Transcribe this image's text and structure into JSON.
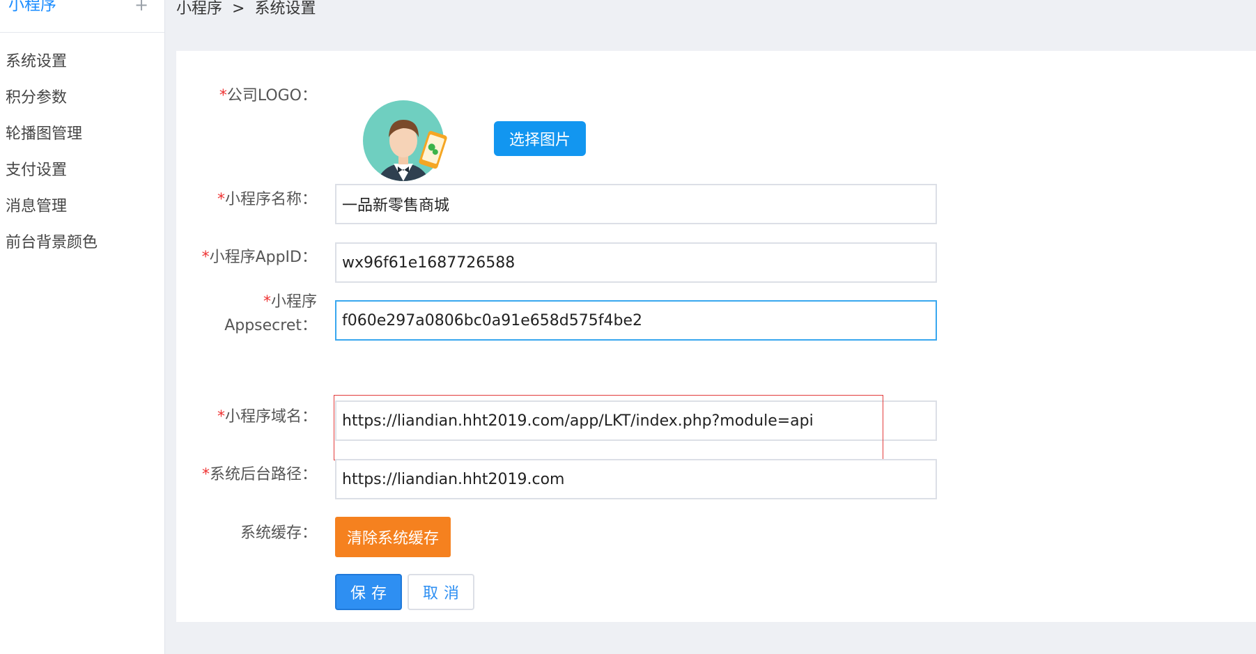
{
  "sidebar": {
    "title": "小程序",
    "plus": "+",
    "items": [
      {
        "label": "系统设置"
      },
      {
        "label": "积分参数"
      },
      {
        "label": "轮播图管理"
      },
      {
        "label": "支付设置"
      },
      {
        "label": "消息管理"
      },
      {
        "label": "前台背景颜色"
      }
    ]
  },
  "breadcrumb": {
    "root": "小程序",
    "separator": ">",
    "current": "系统设置"
  },
  "form": {
    "required_mark": "*",
    "logo": {
      "label": "公司LOGO：",
      "choose_button": "选择图片"
    },
    "app_name": {
      "label": "小程序名称：",
      "value": "一品新零售商城"
    },
    "app_id": {
      "label": "小程序AppID：",
      "value": "wx96f61e1687726588"
    },
    "app_secret": {
      "label_line1": "小程序",
      "label_line2": "Appsecret：",
      "value": "f060e297a0806bc0a91e658d575f4be2"
    },
    "domain": {
      "label": "小程序域名：",
      "value": "https://liandian.hht2019.com/app/LKT/index.php?module=api"
    },
    "backend_path": {
      "label": "系统后台路径：",
      "value": "https://liandian.hht2019.com"
    },
    "cache": {
      "label": "系统缓存：",
      "clear_button": "清除系统缓存"
    },
    "save_button": "保存",
    "cancel_button": "取消"
  },
  "colors": {
    "accent": "#1a8cff",
    "primary_button": "#2e8ff2",
    "warning_button": "#f5811f",
    "required": "#e33333",
    "highlight": "#e23b3b"
  }
}
